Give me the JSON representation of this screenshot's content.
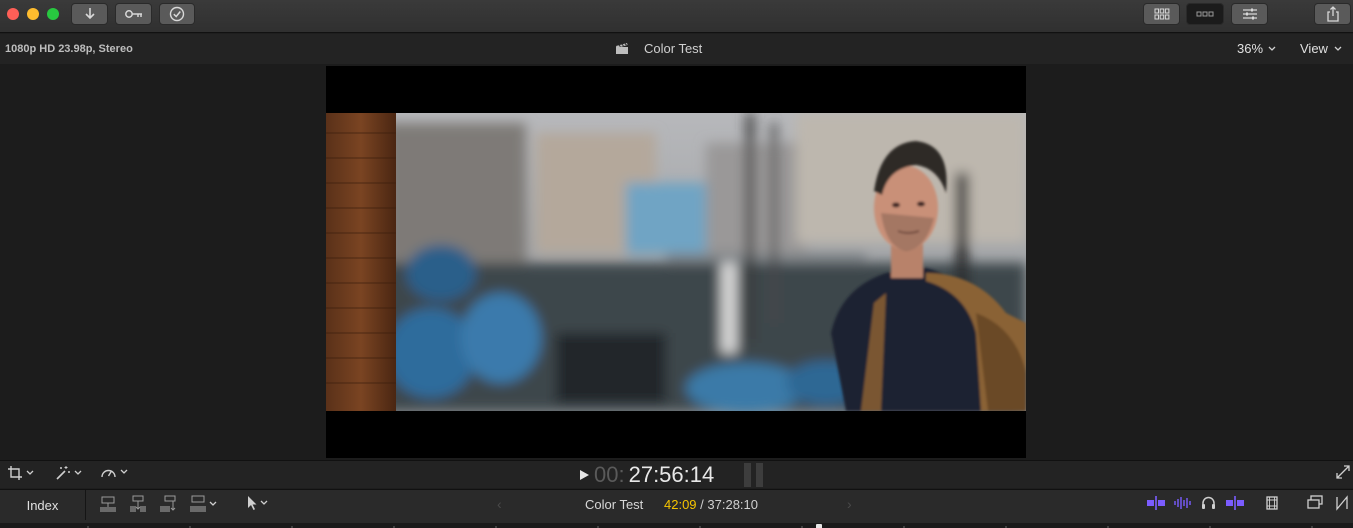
{
  "window": {
    "toolbar_icons": [
      "import-icon",
      "keyword-icon",
      "background-tasks-icon",
      "browser-layout-icon",
      "timeline-layout-icon",
      "inspector-icon",
      "share-icon"
    ]
  },
  "viewer": {
    "format_info": "1080p HD 23.98p, Stereo",
    "project_title": "Color Test",
    "zoom_label": "36%",
    "view_label": "View",
    "timecode_dim": "00:",
    "timecode_main": "27:56:14"
  },
  "timeline": {
    "index_label": "Index",
    "project_title": "Color Test",
    "duration_current": "42:09",
    "duration_separator": " / ",
    "duration_total": "37:28:10"
  },
  "colors": {
    "accent_purple": "#7b5cff",
    "timecode_yellow": "#f5c400",
    "background": "#1e1e1e"
  }
}
